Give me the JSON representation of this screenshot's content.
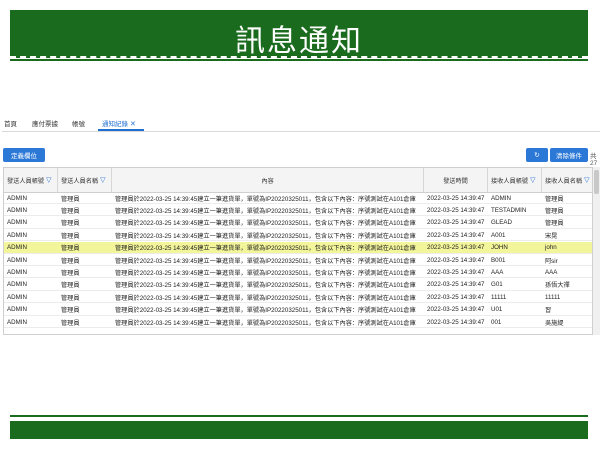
{
  "banner": {
    "title": "訊息通知"
  },
  "tabs": [
    {
      "label": "首頁"
    },
    {
      "label": "應付票據"
    },
    {
      "label": "帳號"
    },
    {
      "label": "通知紀錄",
      "active": true
    }
  ],
  "tab_close_symbol": "✕",
  "toolbar": {
    "define_label": "定義欄位",
    "refresh_symbol": "↻",
    "clear_label": "清除條件",
    "right_count": "共 27"
  },
  "table": {
    "columns": [
      {
        "label": "發送人員帳號",
        "filter": true
      },
      {
        "label": "發送人員名稱",
        "filter": true
      },
      {
        "label": "內容",
        "filter": false
      },
      {
        "label": "發送時間",
        "filter": false
      },
      {
        "label": "接收人員帳號",
        "filter": true
      },
      {
        "label": "接收人員名稱",
        "filter": true
      }
    ],
    "filter_icon": "▽",
    "rows": [
      {
        "sender_id": "ADMIN",
        "sender_name": "管理員",
        "content": "管理員於2022-03-25 14:39:45建立一筆進貨單，單號為IP20220325011，包含以下內容：序號測試在A101倉庫",
        "time": "2022-03-25 14:39:47",
        "receiver_id": "ADMIN",
        "receiver_name": "管理員"
      },
      {
        "sender_id": "ADMIN",
        "sender_name": "管理員",
        "content": "管理員於2022-03-25 14:39:45建立一筆進貨單，單號為IP20220325011，包含以下內容：序號測試在A101倉庫",
        "time": "2022-03-25 14:39:47",
        "receiver_id": "TESTADMIN",
        "receiver_name": "管理員"
      },
      {
        "sender_id": "ADMIN",
        "sender_name": "管理員",
        "content": "管理員於2022-03-25 14:39:45建立一筆進貨單，單號為IP20220325011，包含以下內容：序號測試在A101倉庫",
        "time": "2022-03-25 14:39:47",
        "receiver_id": "GLEAD",
        "receiver_name": "管理員"
      },
      {
        "sender_id": "ADMIN",
        "sender_name": "管理員",
        "content": "管理員於2022-03-25 14:39:45建立一筆進貨單，單號為IP20220325011，包含以下內容：序號測試在A101倉庫",
        "time": "2022-03-25 14:39:47",
        "receiver_id": "A001",
        "receiver_name": "宋晃"
      },
      {
        "sender_id": "ADMIN",
        "sender_name": "管理員",
        "content": "管理員於2022-03-25 14:39:45建立一筆進貨單，單號為IP20220325011，包含以下內容：序號測試在A101倉庫",
        "time": "2022-03-25 14:39:47",
        "receiver_id": "JOHN",
        "receiver_name": "john",
        "highlighted": true
      },
      {
        "sender_id": "ADMIN",
        "sender_name": "管理員",
        "content": "管理員於2022-03-25 14:39:45建立一筆進貨單，單號為IP20220325011，包含以下內容：序號測試在A101倉庫",
        "time": "2022-03-25 14:39:47",
        "receiver_id": "B001",
        "receiver_name": "阿sir"
      },
      {
        "sender_id": "ADMIN",
        "sender_name": "管理員",
        "content": "管理員於2022-03-25 14:39:45建立一筆進貨單，單號為IP20220325011，包含以下內容：序號測試在A101倉庫",
        "time": "2022-03-25 14:39:47",
        "receiver_id": "AAA",
        "receiver_name": "AAA"
      },
      {
        "sender_id": "ADMIN",
        "sender_name": "管理員",
        "content": "管理員於2022-03-25 14:39:45建立一筆進貨單，單號為IP20220325011，包含以下內容：序號測試在A101倉庫",
        "time": "2022-03-25 14:39:47",
        "receiver_id": "G01",
        "receiver_name": "孫悟大禪"
      },
      {
        "sender_id": "ADMIN",
        "sender_name": "管理員",
        "content": "管理員於2022-03-25 14:39:45建立一筆進貨單，單號為IP20220325011，包含以下內容：序號測試在A101倉庫",
        "time": "2022-03-25 14:39:47",
        "receiver_id": "11111",
        "receiver_name": "11111"
      },
      {
        "sender_id": "ADMIN",
        "sender_name": "管理員",
        "content": "管理員於2022-03-25 14:39:45建立一筆進貨單，單號為IP20220325011，包含以下內容：序號測試在A101倉庫",
        "time": "2022-03-25 14:39:47",
        "receiver_id": "U01",
        "receiver_name": "習"
      },
      {
        "sender_id": "ADMIN",
        "sender_name": "管理員",
        "content": "管理員於2022-03-25 14:39:45建立一筆進貨單，單號為IP20220325011，包含以下內容：序號測試在A101倉庫",
        "time": "2022-03-25 14:39:47",
        "receiver_id": "001",
        "receiver_name": "吳施緹"
      }
    ]
  },
  "colors": {
    "banner_green": "#1a6b1d",
    "accent_blue": "#2b78d6",
    "row_highlight": "#f3f59b"
  }
}
